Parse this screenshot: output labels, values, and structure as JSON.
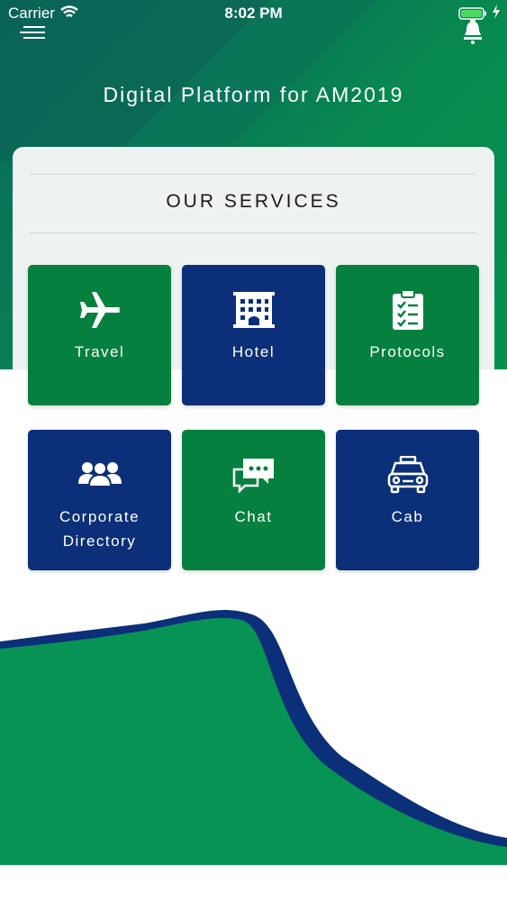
{
  "status_bar": {
    "carrier": "Carrier",
    "time": "8:02 PM"
  },
  "header": {
    "title": "Digital Platform for AM2019"
  },
  "services": {
    "title": "OUR SERVICES",
    "tiles": [
      {
        "label": "Travel",
        "icon": "airplane-icon",
        "color": "#05803f"
      },
      {
        "label": "Hotel",
        "icon": "hotel-icon",
        "color": "#0b2f78"
      },
      {
        "label": "Protocols",
        "icon": "clipboard-check-icon",
        "color": "#05803f"
      },
      {
        "label": "Corporate Directory",
        "icon": "users-icon",
        "color": "#0b2f78"
      },
      {
        "label": "Chat",
        "icon": "chat-icon",
        "color": "#05803f"
      },
      {
        "label": "Cab",
        "icon": "taxi-icon",
        "color": "#0b2f78"
      }
    ]
  },
  "colors": {
    "green": "#05803f",
    "blue": "#0b2f78",
    "wave_green": "#079353",
    "wave_blue": "#0b2f78"
  }
}
